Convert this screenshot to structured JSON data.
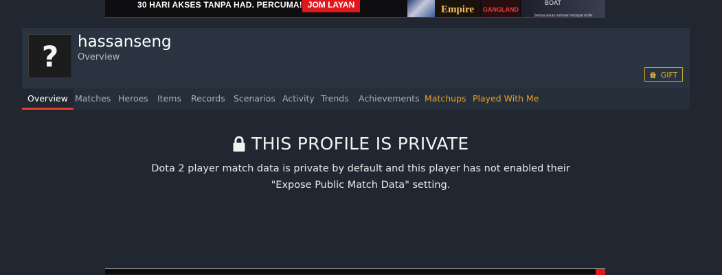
{
  "ad_top": {
    "text": "30 HARI AKSES TANPA HAD. PERCUMA!",
    "button": "JOM LAYAN",
    "brand1": "Empire",
    "brand2": "GANGLAND",
    "brand3_title": "BOAT",
    "brand3_caption": "Semua siaran tontonan terdapat di iflix"
  },
  "profile": {
    "avatar_glyph": "?",
    "name": "hassanseng",
    "section": "Overview",
    "gift_label": "GIFT"
  },
  "tabs": [
    {
      "label": "Overview",
      "active": true
    },
    {
      "label": "Matches"
    },
    {
      "label": "Heroes"
    },
    {
      "label": "Items"
    },
    {
      "label": "Records"
    },
    {
      "label": "Scenarios"
    },
    {
      "label": "Activity"
    },
    {
      "label": "Trends"
    },
    {
      "label": "Achievements"
    },
    {
      "label": "Matchups",
      "highlight": true
    },
    {
      "label": "Played With Me",
      "highlight": true
    }
  ],
  "private_notice": {
    "title": "THIS PROFILE IS PRIVATE",
    "line1": "Dota 2 player match data is private by default and this player has not enabled their",
    "line2": "\"Expose Public Match Data\" setting."
  },
  "colors": {
    "background": "#202731",
    "header": "#2a3440",
    "tab_bar": "#252e39",
    "accent_active": "#e3412a",
    "accent_gold": "#e8a228"
  },
  "icons": {
    "lock": "lock-icon",
    "gift": "gift-icon"
  }
}
